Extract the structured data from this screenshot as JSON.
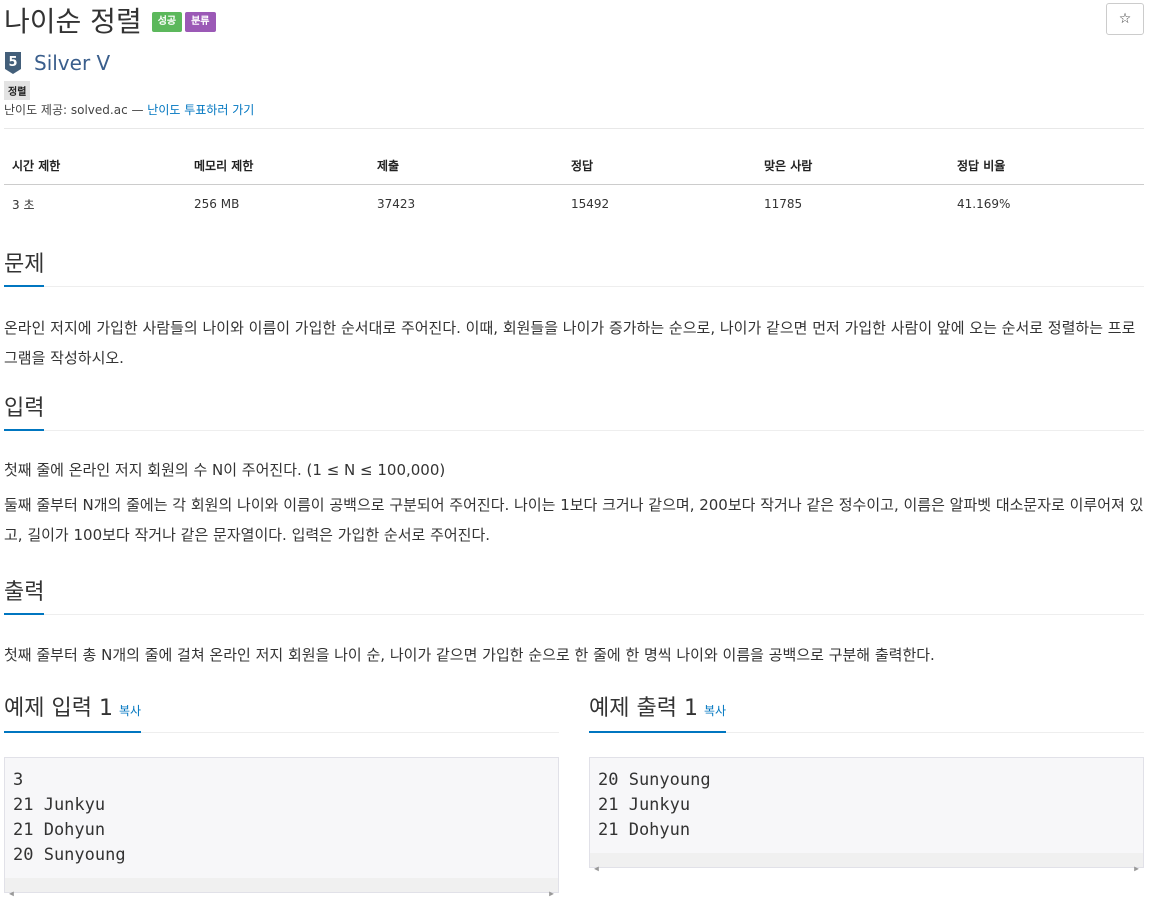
{
  "problem": {
    "title": "나이순 정렬",
    "labels": [
      "성공",
      "분류"
    ],
    "star": "☆",
    "tier_number": "5",
    "tier_name": "Silver V",
    "tag": "정렬",
    "difficulty_prefix": "난이도 제공: solved.ac — ",
    "difficulty_link": "난이도 투표하러 가기"
  },
  "info_table": {
    "headers": [
      "시간 제한",
      "메모리 제한",
      "제출",
      "정답",
      "맞은 사람",
      "정답 비율"
    ],
    "values": [
      "3 초",
      "256 MB",
      "37423",
      "15492",
      "11785",
      "41.169%"
    ]
  },
  "sections": {
    "description": {
      "heading": "문제",
      "text": "온라인 저지에 가입한 사람들의 나이와 이름이 가입한 순서대로 주어진다. 이때, 회원들을 나이가 증가하는 순으로, 나이가 같으면 먼저 가입한 사람이 앞에 오는 순서로 정렬하는 프로그램을 작성하시오."
    },
    "input": {
      "heading": "입력",
      "p1": "첫째 줄에 온라인 저지 회원의 수 N이 주어진다. (1 ≤ N ≤ 100,000)",
      "p2": "둘째 줄부터 N개의 줄에는 각 회원의 나이와 이름이 공백으로 구분되어 주어진다. 나이는 1보다 크거나 같으며, 200보다 작거나 같은 정수이고, 이름은 알파벳 대소문자로 이루어져 있고, 길이가 100보다 작거나 같은 문자열이다. 입력은 가입한 순서로 주어진다."
    },
    "output": {
      "heading": "출력",
      "text": "첫째 줄부터 총 N개의 줄에 걸쳐 온라인 저지 회원을 나이 순, 나이가 같으면 가입한 순으로 한 줄에 한 명씩 나이와 이름을 공백으로 구분해 출력한다."
    }
  },
  "samples": {
    "input": {
      "heading": "예제 입력 1",
      "copy": "복사",
      "content": "3\n21 Junkyu\n21 Dohyun\n20 Sunyoung"
    },
    "output": {
      "heading": "예제 출력 1",
      "copy": "복사",
      "content": "20 Sunyoung\n21 Junkyu\n21 Dohyun"
    }
  }
}
